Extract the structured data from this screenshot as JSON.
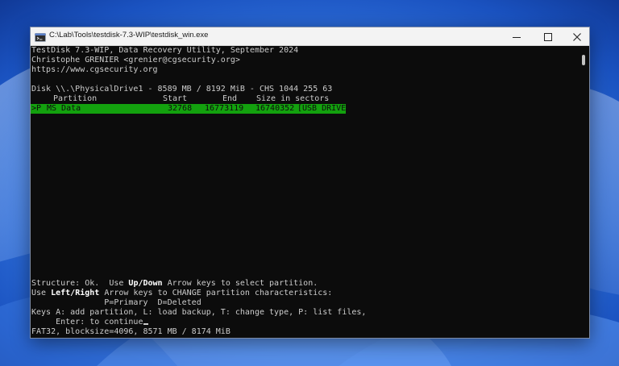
{
  "window": {
    "title": "C:\\Lab\\Tools\\testdisk-7.3-WIP\\testdisk_win.exe"
  },
  "icons": {
    "app": "console-app-icon",
    "minimize": "minimize-icon",
    "maximize": "maximize-icon",
    "close": "close-icon"
  },
  "colors": {
    "console_bg": "#0c0c0c",
    "console_text": "#cccccc",
    "highlight_bg": "#13a10e",
    "highlight_text": "#0c0c0c"
  },
  "header": {
    "line1": "TestDisk 7.3-WIP, Data Recovery Utility, September 2024",
    "line2": "Christophe GRENIER <grenier@cgsecurity.org>",
    "line3": "https://www.cgsecurity.org"
  },
  "disk": {
    "info": "Disk \\\\.\\PhysicalDrive1 - 8589 MB / 8192 MiB - CHS 1044 255 63"
  },
  "table": {
    "headers": {
      "partition": "Partition",
      "start": "Start",
      "end": "End",
      "size": "Size in sectors"
    },
    "rows": [
      {
        "marker": ">P",
        "name": "MS Data",
        "start": "32768",
        "end": "16773119",
        "size": "16740352",
        "label": "[USB DRIVE]"
      }
    ]
  },
  "footer": {
    "l1_pre": "Structure: Ok.  Use ",
    "l1_key": "Up/Down",
    "l1_post": " Arrow keys to select partition.",
    "l2_pre": "Use ",
    "l2_key": "Left/Right",
    "l2_post": " Arrow keys to CHANGE partition characteristics:",
    "l3": "               P=Primary  D=Deleted",
    "l4": "Keys A: add partition, L: load backup, T: change type, P: list files,",
    "l5": "     Enter: to continue",
    "l6": "FAT32, blocksize=4096, 8571 MB / 8174 MiB"
  }
}
